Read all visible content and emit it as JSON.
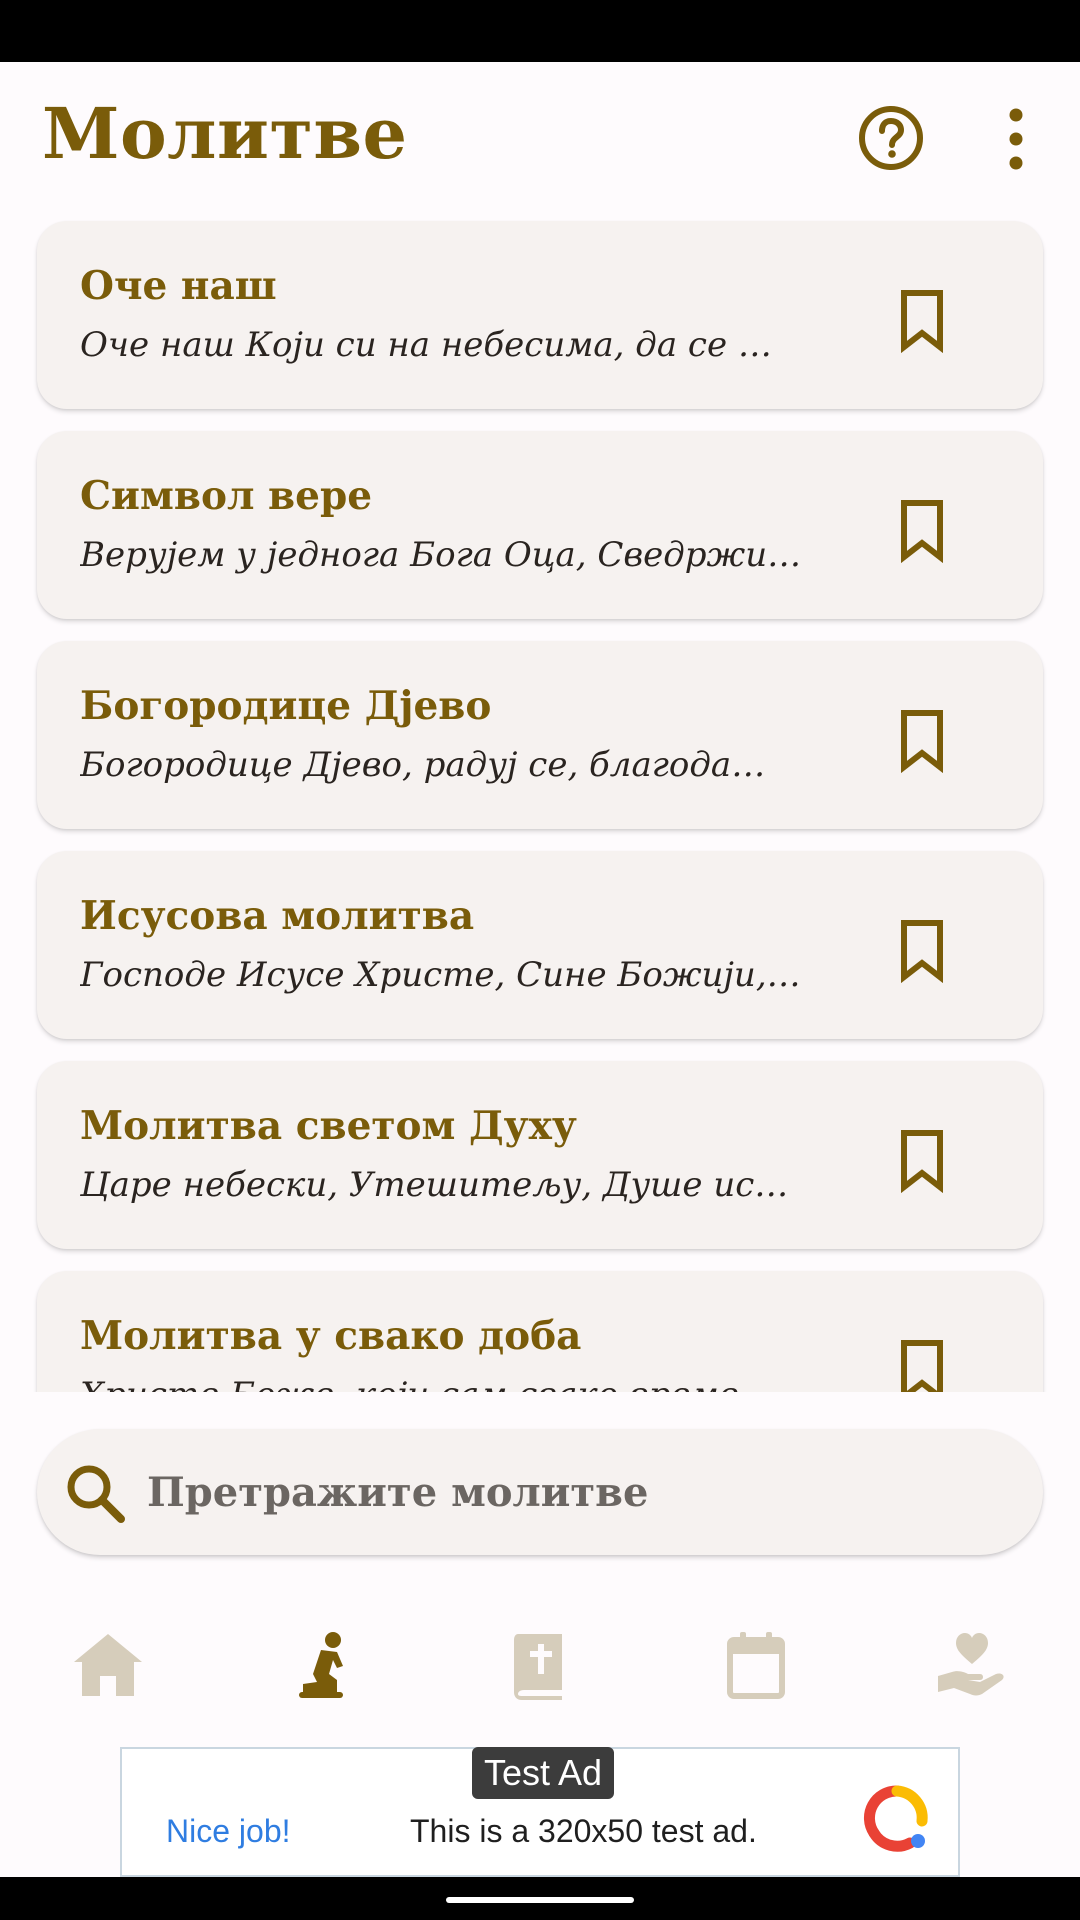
{
  "header": {
    "title": "Молитве",
    "help_icon": "help-circle-icon",
    "more_icon": "more-vertical-icon"
  },
  "prayers": [
    {
      "title": "Оче наш",
      "preview": "Оче наш Који си на небесима, да се …",
      "icon": "bookmark-icon"
    },
    {
      "title": "Символ вере",
      "preview": "Верујем у једнога Бога Оца, Сведржи…",
      "icon": "bookmark-icon"
    },
    {
      "title": "Богородице Дјево",
      "preview": "Богородице Дјево, радуј се, благода…",
      "icon": "bookmark-icon"
    },
    {
      "title": "Исусова молитва",
      "preview": "Господе Исусе Христе, Сине Божији,…",
      "icon": "bookmark-icon"
    },
    {
      "title": "Молитва светом Духу",
      "preview": "Царе небески, Утешитељу, Душе ис…",
      "icon": "bookmark-icon"
    },
    {
      "title": "Молитва у свако доба",
      "preview": "Христе Боже, који сам свако време…",
      "icon": "bookmark-icon"
    }
  ],
  "search": {
    "placeholder": "Претражите молитве",
    "icon": "search-icon"
  },
  "bottom_nav": [
    {
      "id": "home",
      "icon": "home-icon",
      "active": false
    },
    {
      "id": "prayers",
      "icon": "praying-person-icon",
      "active": true
    },
    {
      "id": "bible",
      "icon": "bible-icon",
      "active": false
    },
    {
      "id": "calendar",
      "icon": "calendar-icon",
      "active": false
    },
    {
      "id": "donate",
      "icon": "hand-heart-icon",
      "active": false
    }
  ],
  "ad": {
    "tag": "Test Ad",
    "nice": "Nice job!",
    "text": "This is a 320x50 test ad."
  },
  "colors": {
    "accent": "#7a5c0a",
    "inactive": "#d6cdbb",
    "card": "#f6f2f0",
    "background": "#fefbfd"
  }
}
